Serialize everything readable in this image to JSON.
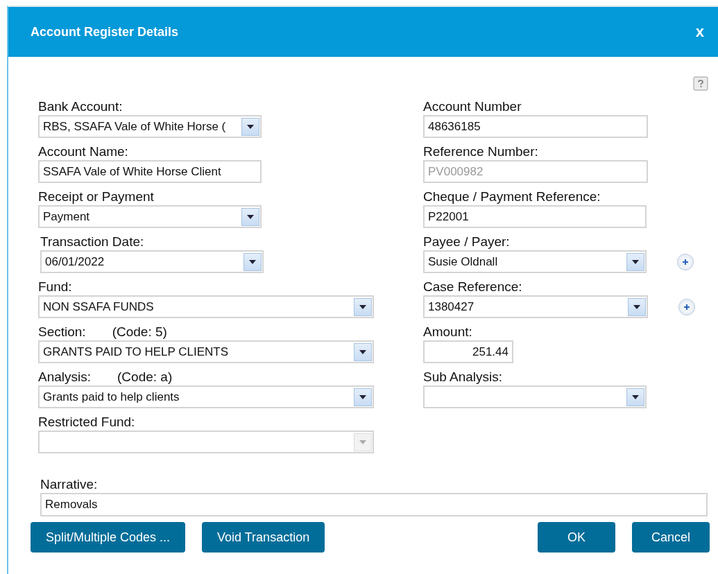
{
  "dialog": {
    "title": "Account Register Details",
    "close": "x"
  },
  "left_fields": [
    {
      "label": "Bank Account:",
      "value": "RBS, SSAFA Vale of White Horse (",
      "kind": "combo",
      "disabled": false
    },
    {
      "label": "Account Name:",
      "value": "SSAFA Vale of White Horse Client",
      "kind": "text",
      "disabled": false
    },
    {
      "label": "Receipt or Payment",
      "value": "Payment",
      "kind": "combo",
      "disabled": false
    },
    {
      "label": "Transaction Date:",
      "value": "06/01/2022",
      "kind": "combo",
      "disabled": false
    },
    {
      "label": "Fund:",
      "value": "NON SSAFA FUNDS",
      "kind": "combo",
      "disabled": false
    },
    {
      "label": "Section:",
      "code": "(Code: 5)",
      "value": "GRANTS PAID TO HELP CLIENTS",
      "kind": "combo",
      "disabled": false
    },
    {
      "label": "Analysis:",
      "code": "(Code: a)",
      "value": "Grants paid to help clients",
      "kind": "combo",
      "disabled": false
    },
    {
      "label": "Restricted Fund:",
      "kind": "combo",
      "disabled": true
    }
  ],
  "right_fields": [
    {
      "label": "Account Number",
      "value": "48636185",
      "kind": "text",
      "disabled": false,
      "add_button": false
    },
    {
      "label": "Reference Number:",
      "value": "PV000982",
      "kind": "text",
      "disabled": true,
      "add_button": false
    },
    {
      "label": "Cheque / Payment Reference:",
      "value": "P22001",
      "kind": "text",
      "disabled": false,
      "add_button": false
    },
    {
      "label": "Payee / Payer:",
      "value": "Susie Oldnall",
      "kind": "combo",
      "disabled": false,
      "add_button": true
    },
    {
      "label": "Case Reference:",
      "value": "1380427",
      "kind": "combo",
      "disabled": false,
      "add_button": true
    },
    {
      "label": "Amount:",
      "value": "251.44",
      "kind": "number",
      "disabled": false,
      "add_button": false
    },
    {
      "label": "Sub Analysis:",
      "kind": "combo",
      "disabled": false,
      "add_button": false
    }
  ],
  "narrative": {
    "label": "Narrative:",
    "value": "Removals"
  },
  "buttons_left": [
    "Split/Multiple Codes ...",
    "Void Transaction"
  ],
  "buttons_right": [
    "OK",
    "Cancel"
  ]
}
